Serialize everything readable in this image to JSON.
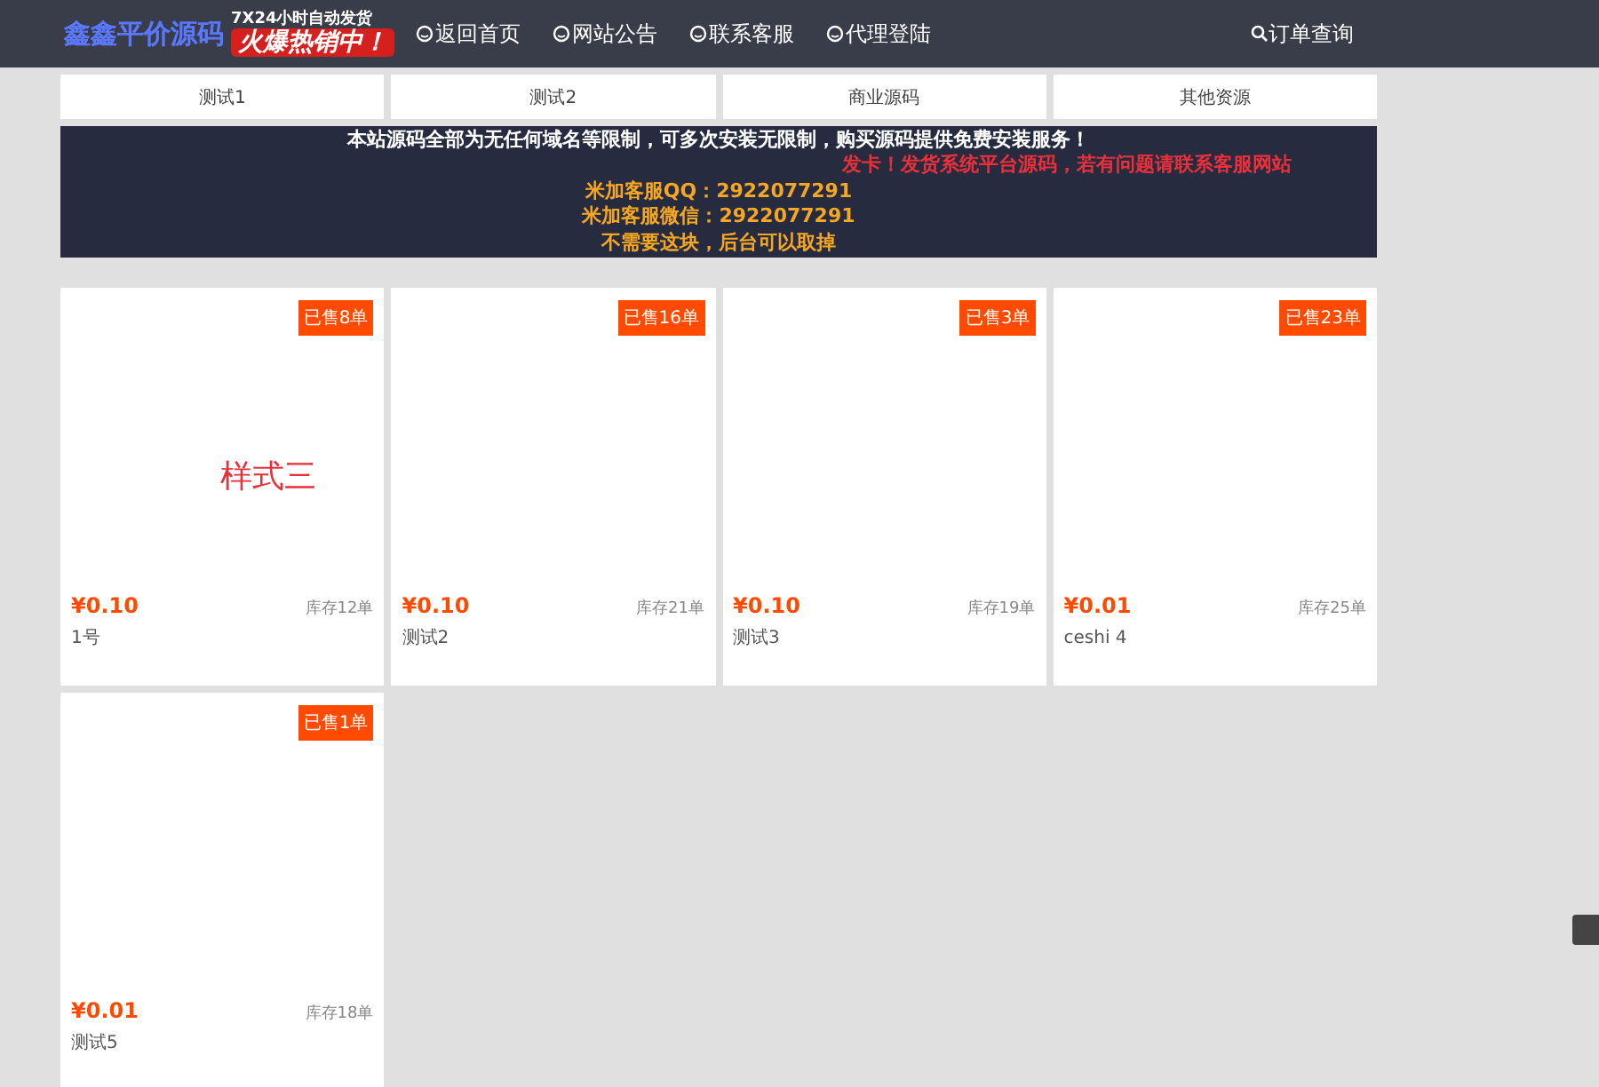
{
  "header": {
    "logo": "鑫鑫平价源码",
    "promo": {
      "line_1": "7X24小时自动发货",
      "line_2": "火爆热销中！"
    },
    "nav": [
      {
        "label": "返回首页",
        "kind": "link"
      },
      {
        "label": "网站公告",
        "kind": "link"
      },
      {
        "label": "联系客服",
        "kind": "link"
      },
      {
        "label": "代理登陆",
        "kind": "link"
      }
    ],
    "search": {
      "label": "订单查询"
    }
  },
  "categories": [
    {
      "label": "测试1"
    },
    {
      "label": "测试2"
    },
    {
      "label": "商业源码"
    },
    {
      "label": "其他资源"
    }
  ],
  "notice": {
    "lines": [
      {
        "text": "本站源码全部为无任何域名等限制，可多次安装无限制，购买源码提供免费安装服务！",
        "color": "#ffffff"
      },
      {
        "text": "发卡！发货系统平台源码，若有问题请联系客服网站",
        "color": "#e8303a"
      },
      {
        "text": "米加客服QQ：2922077291",
        "color": "#f5a623"
      },
      {
        "text": "米加客服微信：2922077291",
        "color": "#f5a623"
      },
      {
        "text": "不需要这块，后台可以取掉",
        "color": "#f5a623"
      }
    ]
  },
  "products": [
    {
      "sold": "已售8单",
      "overlay": "样式三",
      "price": "¥0.10",
      "stock": "库存12单",
      "name": "1号"
    },
    {
      "sold": "已售16单",
      "price": "¥0.10",
      "stock": "库存21单",
      "name": "测试2"
    },
    {
      "sold": "已售3单",
      "price": "¥0.10",
      "stock": "库存19单",
      "name": "测试3"
    },
    {
      "sold": "已售23单",
      "price": "¥0.01",
      "stock": "库存25单",
      "name": "ceshi 4"
    },
    {
      "sold": "已售1单",
      "price": "¥0.01",
      "stock": "库存18单",
      "name": "测试5"
    }
  ]
}
